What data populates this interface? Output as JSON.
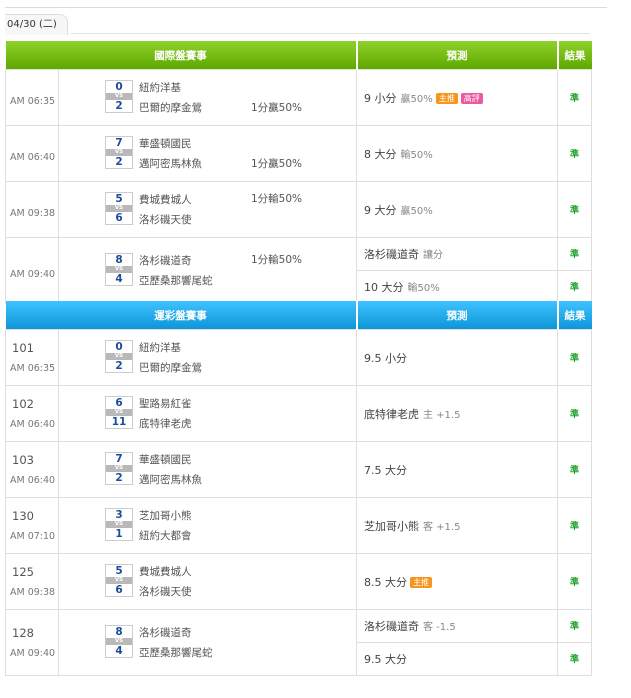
{
  "date_tab": "04/30 (二)",
  "sections": [
    {
      "id": "intl",
      "header": {
        "event": "國際盤賽事",
        "prediction": "預測",
        "result": "結果"
      },
      "rows": [
        {
          "time": "AM 06:35",
          "away_score": "0",
          "home_score": "2",
          "away": "紐約洋基",
          "home": "巴爾的摩金鶯",
          "handicap": "1分贏50%",
          "preds": [
            {
              "main": "9 小分",
              "sub": "贏50%",
              "badges": [
                "主推",
                "高評"
              ]
            }
          ],
          "results": [
            "準"
          ]
        },
        {
          "time": "AM 06:40",
          "away_score": "7",
          "home_score": "2",
          "away": "華盛頓國民",
          "home": "邁阿密馬林魚",
          "handicap": "1分贏50%",
          "preds": [
            {
              "main": "8 大分",
              "sub": "輸50%",
              "badges": []
            }
          ],
          "results": [
            "準"
          ]
        },
        {
          "time": "AM 09:38",
          "away_score": "5",
          "home_score": "6",
          "away": "費城費城人",
          "home": "洛杉磯天使",
          "handicap": "1分輸50%",
          "preds": [
            {
              "main": "9 大分",
              "sub": "贏50%",
              "badges": []
            }
          ],
          "results": [
            "準"
          ]
        },
        {
          "time": "AM 09:40",
          "away_score": "8",
          "home_score": "4",
          "away": "洛杉磯道奇",
          "home": "亞歷桑那響尾蛇",
          "handicap": "1分輸50%",
          "preds": [
            {
              "main": "洛杉磯道奇",
              "sub": "讓分",
              "badges": []
            },
            {
              "main": "10 大分",
              "sub": "輸50%",
              "badges": []
            }
          ],
          "results": [
            "準",
            "準"
          ]
        }
      ]
    },
    {
      "id": "lottery",
      "header": {
        "event": "運彩盤賽事",
        "prediction": "預測",
        "result": "結果"
      },
      "rows": [
        {
          "number": "101",
          "time": "AM 06:35",
          "away_score": "0",
          "home_score": "2",
          "away": "紐約洋基",
          "home": "巴爾的摩金鶯",
          "preds": [
            {
              "main": "9.5 小分",
              "sub": "",
              "badges": []
            }
          ],
          "results": [
            "準"
          ]
        },
        {
          "number": "102",
          "time": "AM 06:40",
          "away_score": "6",
          "home_score": "11",
          "away": "聖路易紅雀",
          "home": "底特律老虎",
          "preds": [
            {
              "main": "底特律老虎",
              "sub": "主 +1.5",
              "badges": []
            }
          ],
          "results": [
            "準"
          ]
        },
        {
          "number": "103",
          "time": "AM 06:40",
          "away_score": "7",
          "home_score": "2",
          "away": "華盛頓國民",
          "home": "邁阿密馬林魚",
          "preds": [
            {
              "main": "7.5 大分",
              "sub": "",
              "badges": []
            }
          ],
          "results": [
            "準"
          ]
        },
        {
          "number": "130",
          "time": "AM 07:10",
          "away_score": "3",
          "home_score": "1",
          "away": "芝加哥小熊",
          "home": "紐約大都會",
          "preds": [
            {
              "main": "芝加哥小熊",
              "sub": "客 +1.5",
              "badges": []
            }
          ],
          "results": [
            "準"
          ]
        },
        {
          "number": "125",
          "time": "AM 09:38",
          "away_score": "5",
          "home_score": "6",
          "away": "費城費城人",
          "home": "洛杉磯天使",
          "preds": [
            {
              "main": "8.5 大分",
              "sub": "",
              "badges": [
                "主推"
              ]
            }
          ],
          "results": [
            "準"
          ]
        },
        {
          "number": "128",
          "time": "AM 09:40",
          "away_score": "8",
          "home_score": "4",
          "away": "洛杉磯道奇",
          "home": "亞歷桑那響尾蛇",
          "preds": [
            {
              "main": "洛杉磯道奇",
              "sub": "客 -1.5",
              "badges": []
            },
            {
              "main": "9.5 大分",
              "sub": "",
              "badges": []
            }
          ],
          "results": [
            "準",
            "準"
          ]
        }
      ]
    }
  ],
  "colors": {
    "intl_header": "#6cb80e",
    "lottery_header": "#1aa6e6",
    "score": "#1b4d99",
    "result_mark": "#1fa32d",
    "badge_orange": "#f7941d",
    "badge_pink": "#ea5aa0"
  }
}
